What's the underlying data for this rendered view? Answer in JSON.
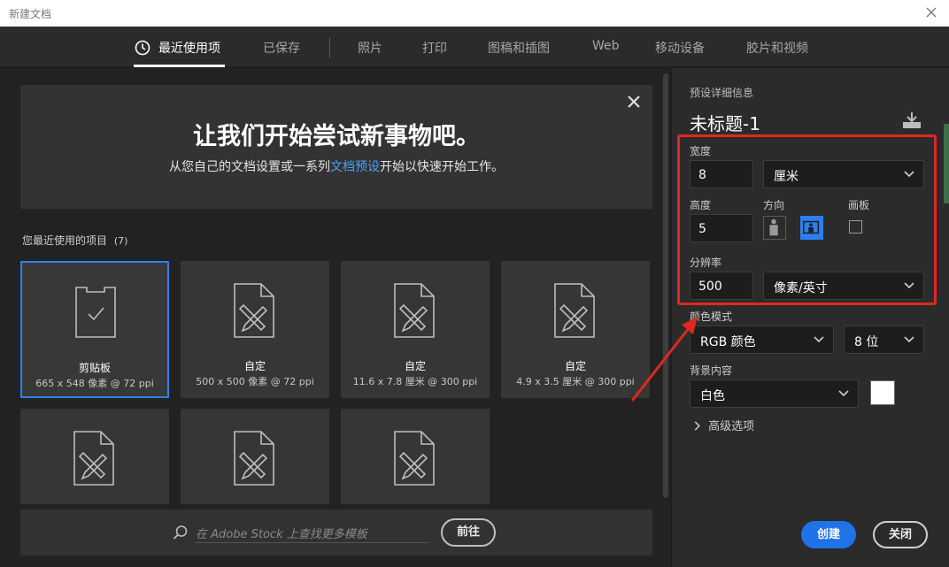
{
  "window": {
    "title": "新建文档"
  },
  "nav": {
    "tabs": [
      {
        "label": "最近使用项",
        "active": true
      },
      {
        "label": "已保存"
      },
      {
        "label": "照片"
      },
      {
        "label": "打印"
      },
      {
        "label": "图稿和插图"
      },
      {
        "label": "Web"
      },
      {
        "label": "移动设备"
      },
      {
        "label": "胶片和视频"
      }
    ]
  },
  "banner": {
    "headline": "让我们开始尝试新事物吧。",
    "sub_before": "从您自己的文档设置或一系列",
    "sub_link": "文档预设",
    "sub_after": "开始以快速开始工作。"
  },
  "recent": {
    "label": "您最近使用的项目",
    "count": "(7)",
    "items": [
      {
        "name": "剪贴板",
        "info": "665 x 548 像素 @ 72 ppi",
        "icon": "clipboard-icon",
        "selected": true
      },
      {
        "name": "自定",
        "info": "500 x 500 像素 @ 72 ppi",
        "icon": "document-tools-icon"
      },
      {
        "name": "自定",
        "info": "11.6 x 7.8 厘米 @ 300 ppi",
        "icon": "document-tools-icon"
      },
      {
        "name": "自定",
        "info": "4.9 x 3.5 厘米 @ 300 ppi",
        "icon": "document-tools-icon"
      },
      {
        "name": "",
        "info": "",
        "icon": "document-tools-icon"
      },
      {
        "name": "",
        "info": "",
        "icon": "document-tools-icon"
      },
      {
        "name": "",
        "info": "",
        "icon": "document-tools-icon"
      }
    ]
  },
  "stock": {
    "placeholder": "在 Adobe Stock 上查找更多模板",
    "go_label": "前往"
  },
  "details": {
    "section_title": "预设详细信息",
    "doc_name": "未标题-1",
    "width_label": "宽度",
    "width_value": "8",
    "width_unit": "厘米",
    "height_label": "高度",
    "height_value": "5",
    "orientation_label": "方向",
    "orientation_selected": "landscape",
    "artboard_label": "画板",
    "artboard_checked": false,
    "resolution_label": "分辨率",
    "resolution_value": "500",
    "resolution_unit": "像素/英寸",
    "color_mode_label": "颜色模式",
    "color_mode": "RGB 颜色",
    "bit_depth": "8 位",
    "background_label": "背景内容",
    "background": "白色",
    "background_swatch": "#ffffff",
    "advanced_label": "高级选项"
  },
  "actions": {
    "create_label": "创建",
    "close_label": "关闭"
  },
  "colors": {
    "accent": "#1f73e8",
    "highlight": "#e0281e"
  }
}
